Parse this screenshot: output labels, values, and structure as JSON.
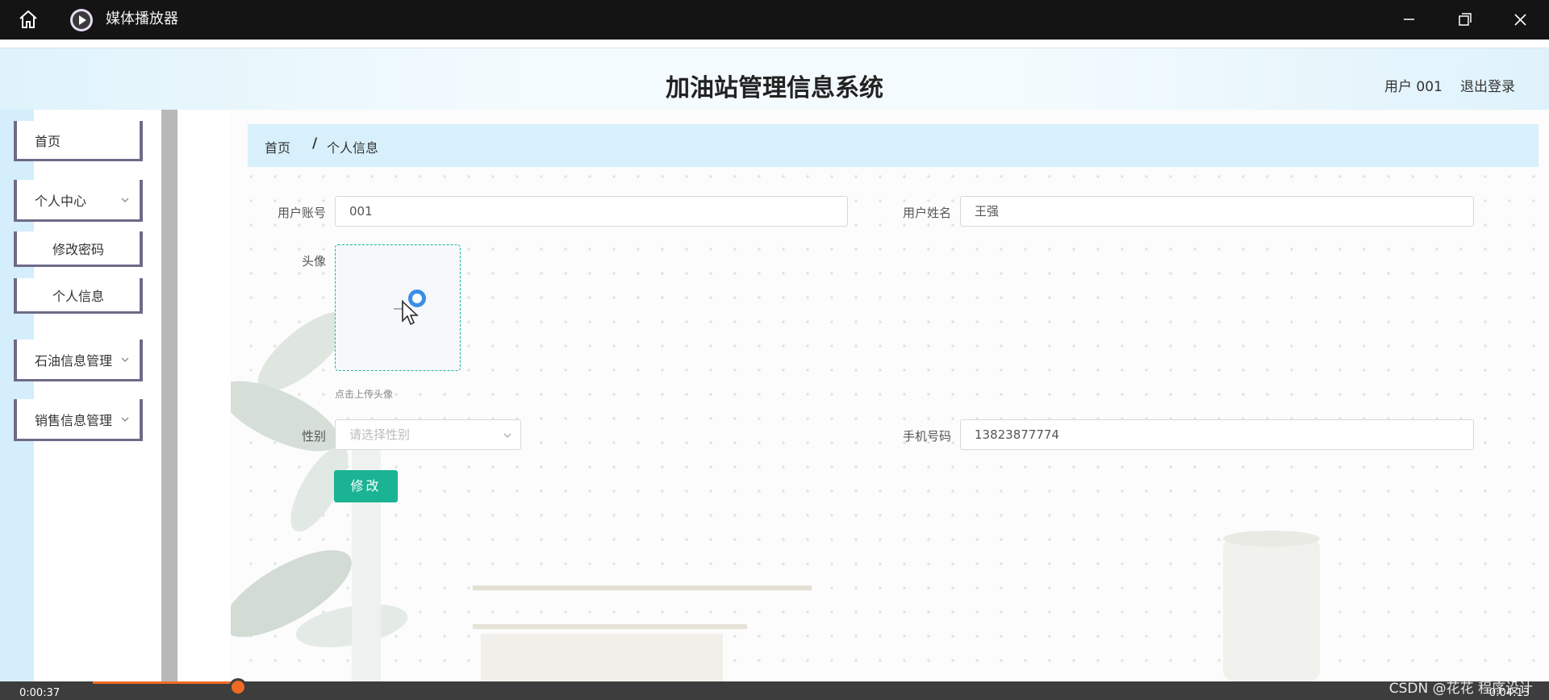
{
  "window": {
    "title": "媒体播放器",
    "icons": {
      "home": "home-icon",
      "app": "play-circle-icon",
      "minimize": "minimize-icon",
      "maximize": "restore-icon",
      "close": "close-icon"
    }
  },
  "header": {
    "site_title": "加油站管理信息系统",
    "user_label": "用户 001",
    "logout_label": "退出登录"
  },
  "sidebar": {
    "items": [
      {
        "label": "首页"
      },
      {
        "label": "个人中心",
        "expandable": true
      },
      {
        "label": "修改密码"
      },
      {
        "label": "个人信息"
      },
      {
        "label": "石油信息管理",
        "expandable": true
      },
      {
        "label": "销售信息管理",
        "expandable": true
      }
    ]
  },
  "breadcrumb": {
    "home": "首页",
    "separator": "/",
    "current": "个人信息"
  },
  "form": {
    "account_label": "用户账号",
    "account_value": "001",
    "name_label": "用户姓名",
    "name_value": "王强",
    "avatar_label": "头像",
    "avatar_hint": "点击上传头像",
    "gender_label": "性别",
    "gender_placeholder": "请选择性别",
    "phone_label": "手机号码",
    "phone_value": "13823877774",
    "submit_label": "修改"
  },
  "player": {
    "time_elapsed": "0:00:37",
    "time_total": "0:04:13",
    "progress": 0.15,
    "watermark": "CSDN @花花 程序设计"
  },
  "colors": {
    "accent": "#1ab394",
    "breadcrumb_bg": "#d8f0fc",
    "sidebar_border": "#6f6a88",
    "progress": "#f06a23"
  }
}
